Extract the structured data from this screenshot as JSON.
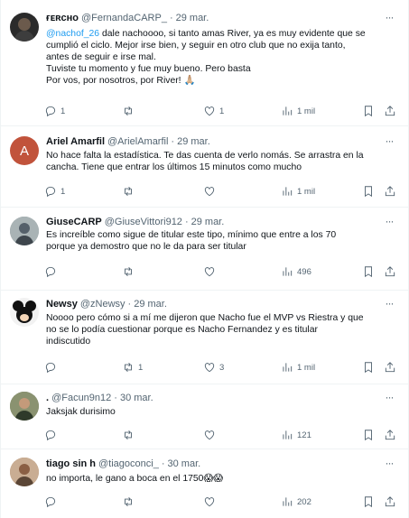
{
  "icons": {
    "reply": "reply-icon",
    "retweet": "retweet-icon",
    "like": "heart-icon",
    "views": "views-icon",
    "bookmark": "bookmark-icon",
    "share": "share-icon",
    "more": "more-icon"
  },
  "colors": {
    "link": "#1d9bf0",
    "secondary": "#536471"
  },
  "tweets": [
    {
      "name": "ғᴇʀᴄʜᴏ",
      "handle": "@FernandaCARP_",
      "sep": "·",
      "time": "29 mar.",
      "mention": "@nachof_26",
      "lines": [
        " dale nachoooo, si tanto amas River, ya es muy evidente que se",
        "cumplió el ciclo. Mejor irse bien, y seguir en otro club que no exija tanto,",
        "antes de seguir e irse mal.",
        "Tuviste tu momento y fue muy bueno. Pero basta",
        "Por vos, por nosotros, por River! 🙏🏼"
      ],
      "replies": "1",
      "retweets": "",
      "likes": "1",
      "views": "1 mil"
    },
    {
      "name": "Ariel Amarfil",
      "handle": "@ArielAmarfil",
      "sep": "·",
      "time": "29 mar.",
      "avatar_letter": "A",
      "lines": [
        "No hace falta la estadística. Te das cuenta de verlo nomás. Se arrastra en la",
        "cancha. Tiene que entrar los últimos 15 minutos como mucho"
      ],
      "replies": "1",
      "retweets": "",
      "likes": "",
      "views": "1 mil"
    },
    {
      "name": "GiuseCARP",
      "handle": "@GiuseVittori912",
      "sep": "·",
      "time": "29 mar.",
      "lines": [
        "Es increíble como sigue de titular este tipo, mínimo que entre a los 70",
        "porque ya demostro que no le da para ser titular"
      ],
      "replies": "",
      "retweets": "",
      "likes": "",
      "views": "496"
    },
    {
      "name": "Newsy",
      "handle": "@zNewsy",
      "sep": "·",
      "time": "29 mar.",
      "lines": [
        "Noooo pero cómo si a mí me dijeron que Nacho fue el MVP vs Riestra y que",
        "no se lo podía cuestionar porque es Nacho Fernandez  y es titular",
        "indiscutido"
      ],
      "replies": "",
      "retweets": "1",
      "likes": "3",
      "views": "1 mil"
    },
    {
      "name": ".",
      "handle": "@Facun9n12",
      "sep": "·",
      "time": "30 mar.",
      "lines": [
        "Jaksjak durisimo"
      ],
      "replies": "",
      "retweets": "",
      "likes": "",
      "views": "121"
    },
    {
      "name": "tiago sin h",
      "handle": "@tiagoconci_",
      "sep": "·",
      "time": "30 mar.",
      "lines": [
        "no importa, le gano a boca en el 1750😱😱"
      ],
      "replies": "",
      "retweets": "",
      "likes": "",
      "views": "202"
    }
  ]
}
